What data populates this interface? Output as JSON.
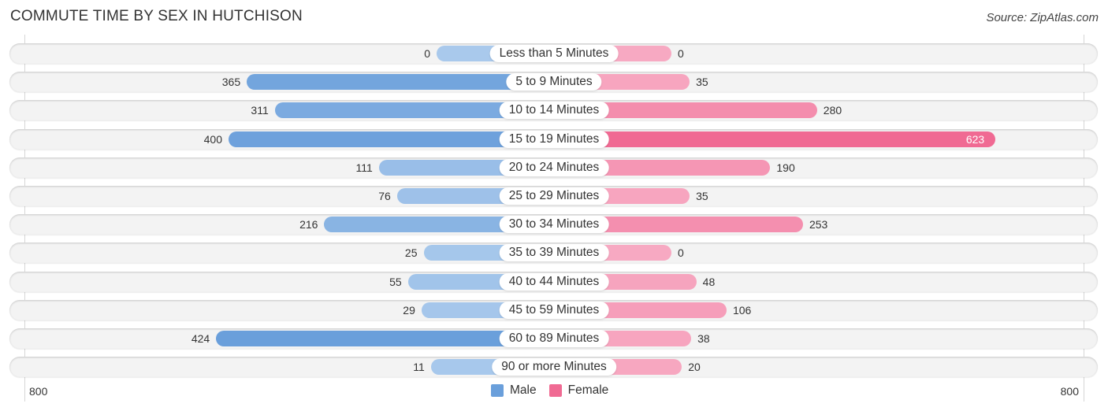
{
  "title": "COMMUTE TIME BY SEX IN HUTCHISON",
  "source": "Source: ZipAtlas.com",
  "colors": {
    "male_strong": "#6a9fdb",
    "male_light": "#a9c9ec",
    "female_strong": "#f06a93",
    "female_light": "#f7a9c2"
  },
  "chart_data": {
    "type": "bar",
    "orientation": "horizontal-diverging",
    "title": "COMMUTE TIME BY SEX IN HUTCHISON",
    "categories": [
      "Less than 5 Minutes",
      "5 to 9 Minutes",
      "10 to 14 Minutes",
      "15 to 19 Minutes",
      "20 to 24 Minutes",
      "25 to 29 Minutes",
      "30 to 34 Minutes",
      "35 to 39 Minutes",
      "40 to 44 Minutes",
      "45 to 59 Minutes",
      "60 to 89 Minutes",
      "90 or more Minutes"
    ],
    "series": [
      {
        "name": "Male",
        "side": "left",
        "values": [
          0,
          365,
          311,
          400,
          111,
          76,
          216,
          25,
          55,
          29,
          424,
          11
        ]
      },
      {
        "name": "Female",
        "side": "right",
        "values": [
          0,
          35,
          280,
          623,
          190,
          35,
          253,
          0,
          48,
          106,
          38,
          20
        ]
      }
    ],
    "axis": {
      "left_label": "800",
      "right_label": "800",
      "range": [
        0,
        800
      ]
    },
    "legend": {
      "position": "bottom-center",
      "entries": [
        "Male",
        "Female"
      ]
    },
    "grid": false
  }
}
